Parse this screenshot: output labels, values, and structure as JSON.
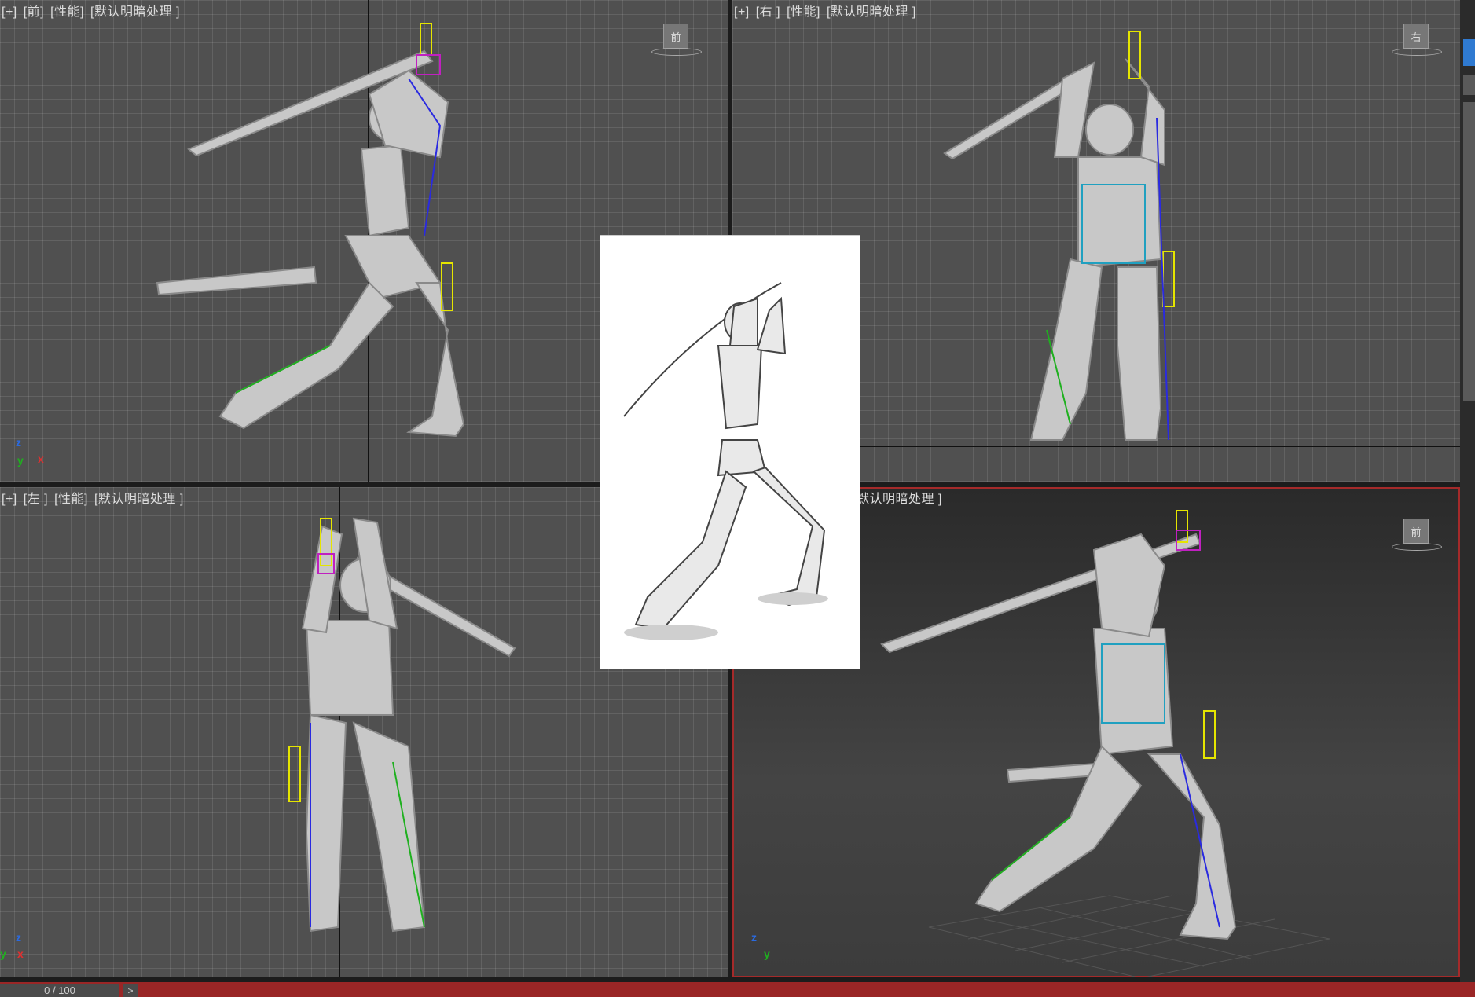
{
  "viewports": {
    "front": {
      "plus": "[+]",
      "view": "[前]",
      "mode": "[性能]",
      "shading": "[默认明暗处理 ]",
      "cube": "前"
    },
    "right": {
      "plus": "[+]",
      "view": "[右 ]",
      "mode": "[性能]",
      "shading": "[默认明暗处理 ]",
      "cube": "右"
    },
    "left": {
      "plus": "[+]",
      "view": "[左 ]",
      "mode": "[性能]",
      "shading": "[默认明暗处理 ]"
    },
    "persp": {
      "shading": "默认明暗处理 ]",
      "cube": "前"
    }
  },
  "gizmo": {
    "z": "z",
    "y": "y",
    "x": "x"
  },
  "timeline": {
    "frame": "0 / 100",
    "next": ">"
  },
  "colors": {
    "active_border": "#a52a2a",
    "timeline": "#9a2626",
    "grid": "#505050"
  }
}
